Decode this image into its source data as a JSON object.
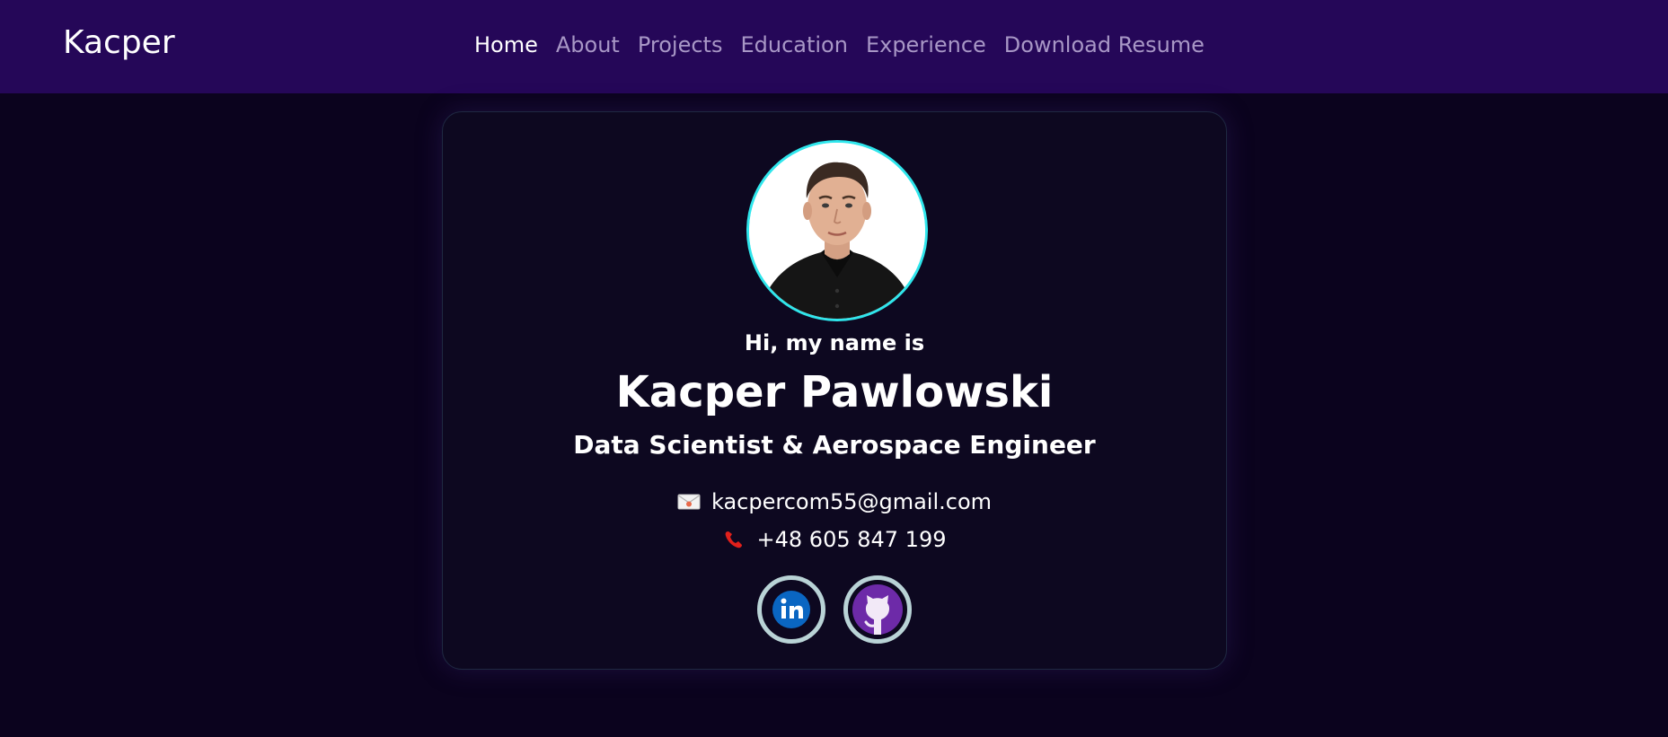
{
  "nav": {
    "brand": "Kacper",
    "links": [
      "Home",
      "About",
      "Projects",
      "Education",
      "Experience",
      "Download Resume"
    ],
    "active": "Home"
  },
  "profile": {
    "greeting": "Hi, my name is",
    "name": "Kacper Pawlowski",
    "title": "Data Scientist & Aerospace Engineer",
    "email": "kacpercom55@gmail.com",
    "phone": "+48 605 847 199"
  },
  "icons": {
    "email": "envelope-icon",
    "phone": "telephone-icon",
    "linkedin": "linkedin-icon",
    "github": "github-icon"
  },
  "colors": {
    "navbar_bg": "#250758",
    "page_bg": "#0b031e",
    "nav_inactive": "#a897c6",
    "avatar_border": "#2fe6ec"
  }
}
